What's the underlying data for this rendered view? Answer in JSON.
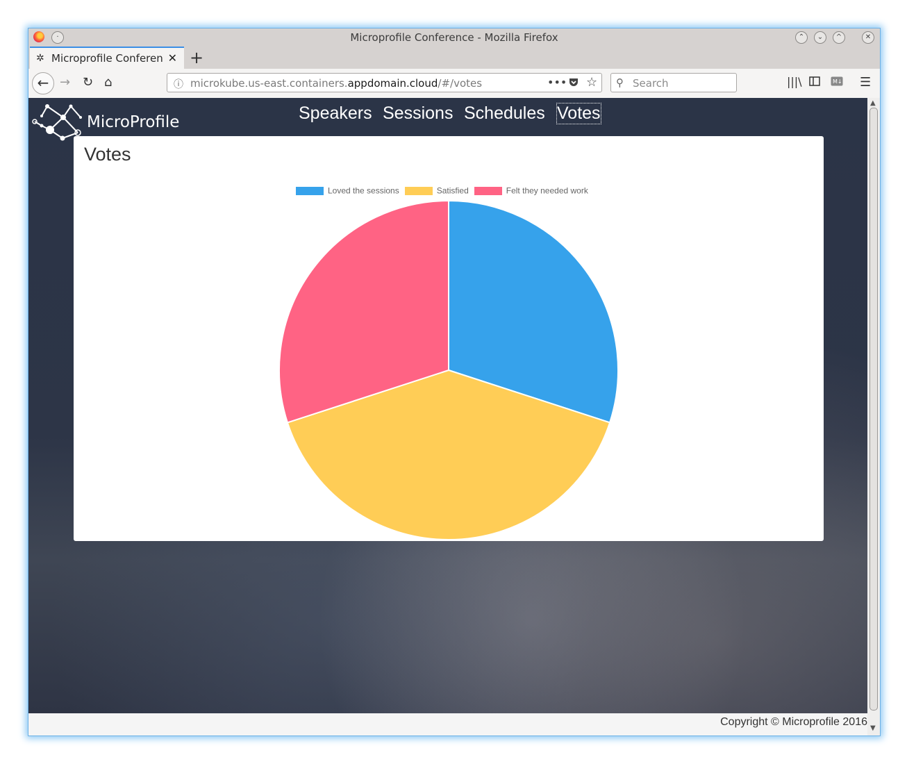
{
  "window": {
    "title": "Microprofile Conference - Mozilla Firefox"
  },
  "tab": {
    "label": "Microprofile Conference",
    "close": "✕",
    "new_tab": "+"
  },
  "urlbar": {
    "url_prefix": "microkube.us-east.containers.",
    "url_host": "appdomain.cloud",
    "url_suffix": "/#/votes",
    "more": "•••"
  },
  "searchbar": {
    "placeholder": "Search"
  },
  "site": {
    "brand": "MicroProfile",
    "nav": [
      {
        "label": "Speakers"
      },
      {
        "label": "Sessions"
      },
      {
        "label": "Schedules"
      },
      {
        "label": "Votes",
        "active": true
      }
    ]
  },
  "panel": {
    "title": "Votes"
  },
  "chart_data": {
    "type": "pie",
    "categories": [
      "Loved the sessions",
      "Satisfied",
      "Felt they needed work"
    ],
    "values": [
      3,
      4,
      3
    ],
    "colors": [
      "#36a2eb",
      "#ffcd56",
      "#ff6384"
    ],
    "legend": "top"
  },
  "footer": {
    "copyright": "Copyright © Microprofile 2016"
  },
  "icons": {
    "firefox": "firefox-icon",
    "back": "back-arrow-icon",
    "forward": "forward-arrow-icon",
    "reload": "reload-icon",
    "home": "home-icon",
    "info": "info-icon",
    "pocket": "pocket-icon",
    "bookmark": "star-icon",
    "library": "library-icon",
    "sidebar": "sidebar-icon",
    "menu": "hamburger-menu-icon"
  }
}
